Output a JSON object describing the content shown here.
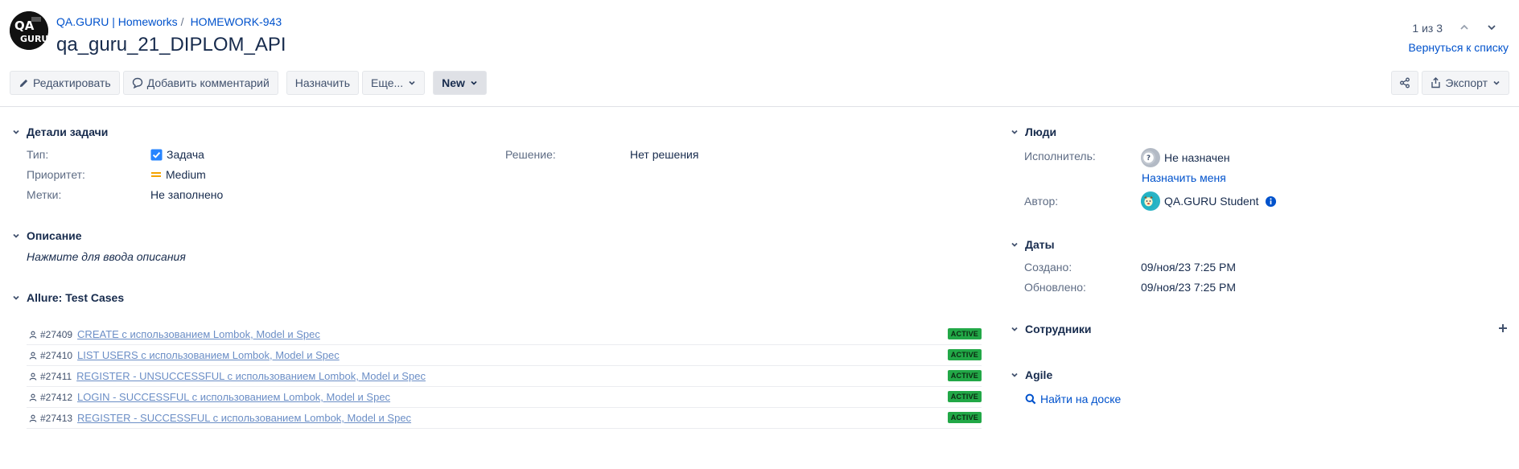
{
  "breadcrumbs": {
    "project": "QA.GURU | Homeworks",
    "issue_key": "HOMEWORK-943"
  },
  "title": "qa_guru_21_DIPLOM_API",
  "pager": {
    "position": "1 из 3",
    "back_link": "Вернуться к списку"
  },
  "toolbar": {
    "edit": "Редактировать",
    "comment": "Добавить комментарий",
    "assign": "Назначить",
    "more": "Еще...",
    "status": "New",
    "export": "Экспорт"
  },
  "details": {
    "heading": "Детали задачи",
    "type_label": "Тип:",
    "type_value": "Задача",
    "priority_label": "Приоритет:",
    "priority_value": "Medium",
    "labels_label": "Метки:",
    "labels_value": "Не заполнено",
    "resolution_label": "Решение:",
    "resolution_value": "Нет решения"
  },
  "description": {
    "heading": "Описание",
    "placeholder": "Нажмите для ввода описания"
  },
  "allure": {
    "heading": "Allure: Test Cases",
    "cases": [
      {
        "id": "#27409",
        "name": "CREATE с использованием Lombok, Model и Spec",
        "status": "ACTIVE"
      },
      {
        "id": "#27410",
        "name": "LIST USERS с использованием Lombok, Model и Spec",
        "status": "ACTIVE"
      },
      {
        "id": "#27411",
        "name": "REGISTER - UNSUCCESSFUL с использованием Lombok, Model и Spec",
        "status": "ACTIVE"
      },
      {
        "id": "#27412",
        "name": "LOGIN - SUCCESSFUL с использованием Lombok, Model и Spec",
        "status": "ACTIVE"
      },
      {
        "id": "#27413",
        "name": "REGISTER - SUCCESSFUL с использованием Lombok, Model и Spec",
        "status": "ACTIVE"
      }
    ]
  },
  "people": {
    "heading": "Люди",
    "assignee_label": "Исполнитель:",
    "assignee_value": "Не назначен",
    "assign_me": "Назначить меня",
    "author_label": "Автор:",
    "author_value": "QA.GURU Student"
  },
  "dates": {
    "heading": "Даты",
    "created_label": "Создано:",
    "created_value": "09/ноя/23 7:25 PM",
    "updated_label": "Обновлено:",
    "updated_value": "09/ноя/23 7:25 PM"
  },
  "staff": {
    "heading": "Сотрудники"
  },
  "agile": {
    "heading": "Agile",
    "find_on_board": "Найти на доске"
  },
  "colors": {
    "link": "#0052cc",
    "badge": "#22a847",
    "priority": "#f4a300",
    "checkbox": "#2684ff"
  }
}
